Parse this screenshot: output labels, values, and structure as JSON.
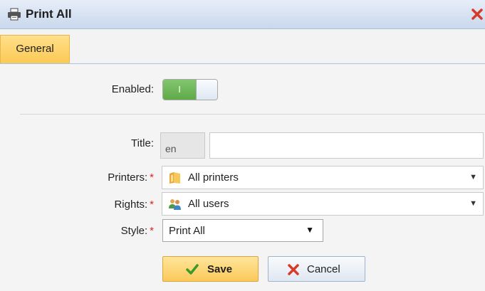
{
  "window": {
    "title": "Print All",
    "close_icon": "close-icon"
  },
  "tabs": [
    {
      "label": "General",
      "active": true
    }
  ],
  "form": {
    "enabled_label": "Enabled:",
    "enabled_toggle_text": "I",
    "enabled": true,
    "title_label": "Title:",
    "title_lang": "en",
    "title_value": "",
    "printers_label": "Printers:",
    "printers_value": "All printers",
    "rights_label": "Rights:",
    "rights_value": "All users",
    "style_label": "Style:",
    "style_value": "Print All",
    "required_mark": "*"
  },
  "buttons": {
    "save": "Save",
    "cancel": "Cancel"
  },
  "colors": {
    "accent": "#fbc954",
    "toggle_on": "#6cb656",
    "required": "#dd2222",
    "close": "#d83a2a"
  }
}
